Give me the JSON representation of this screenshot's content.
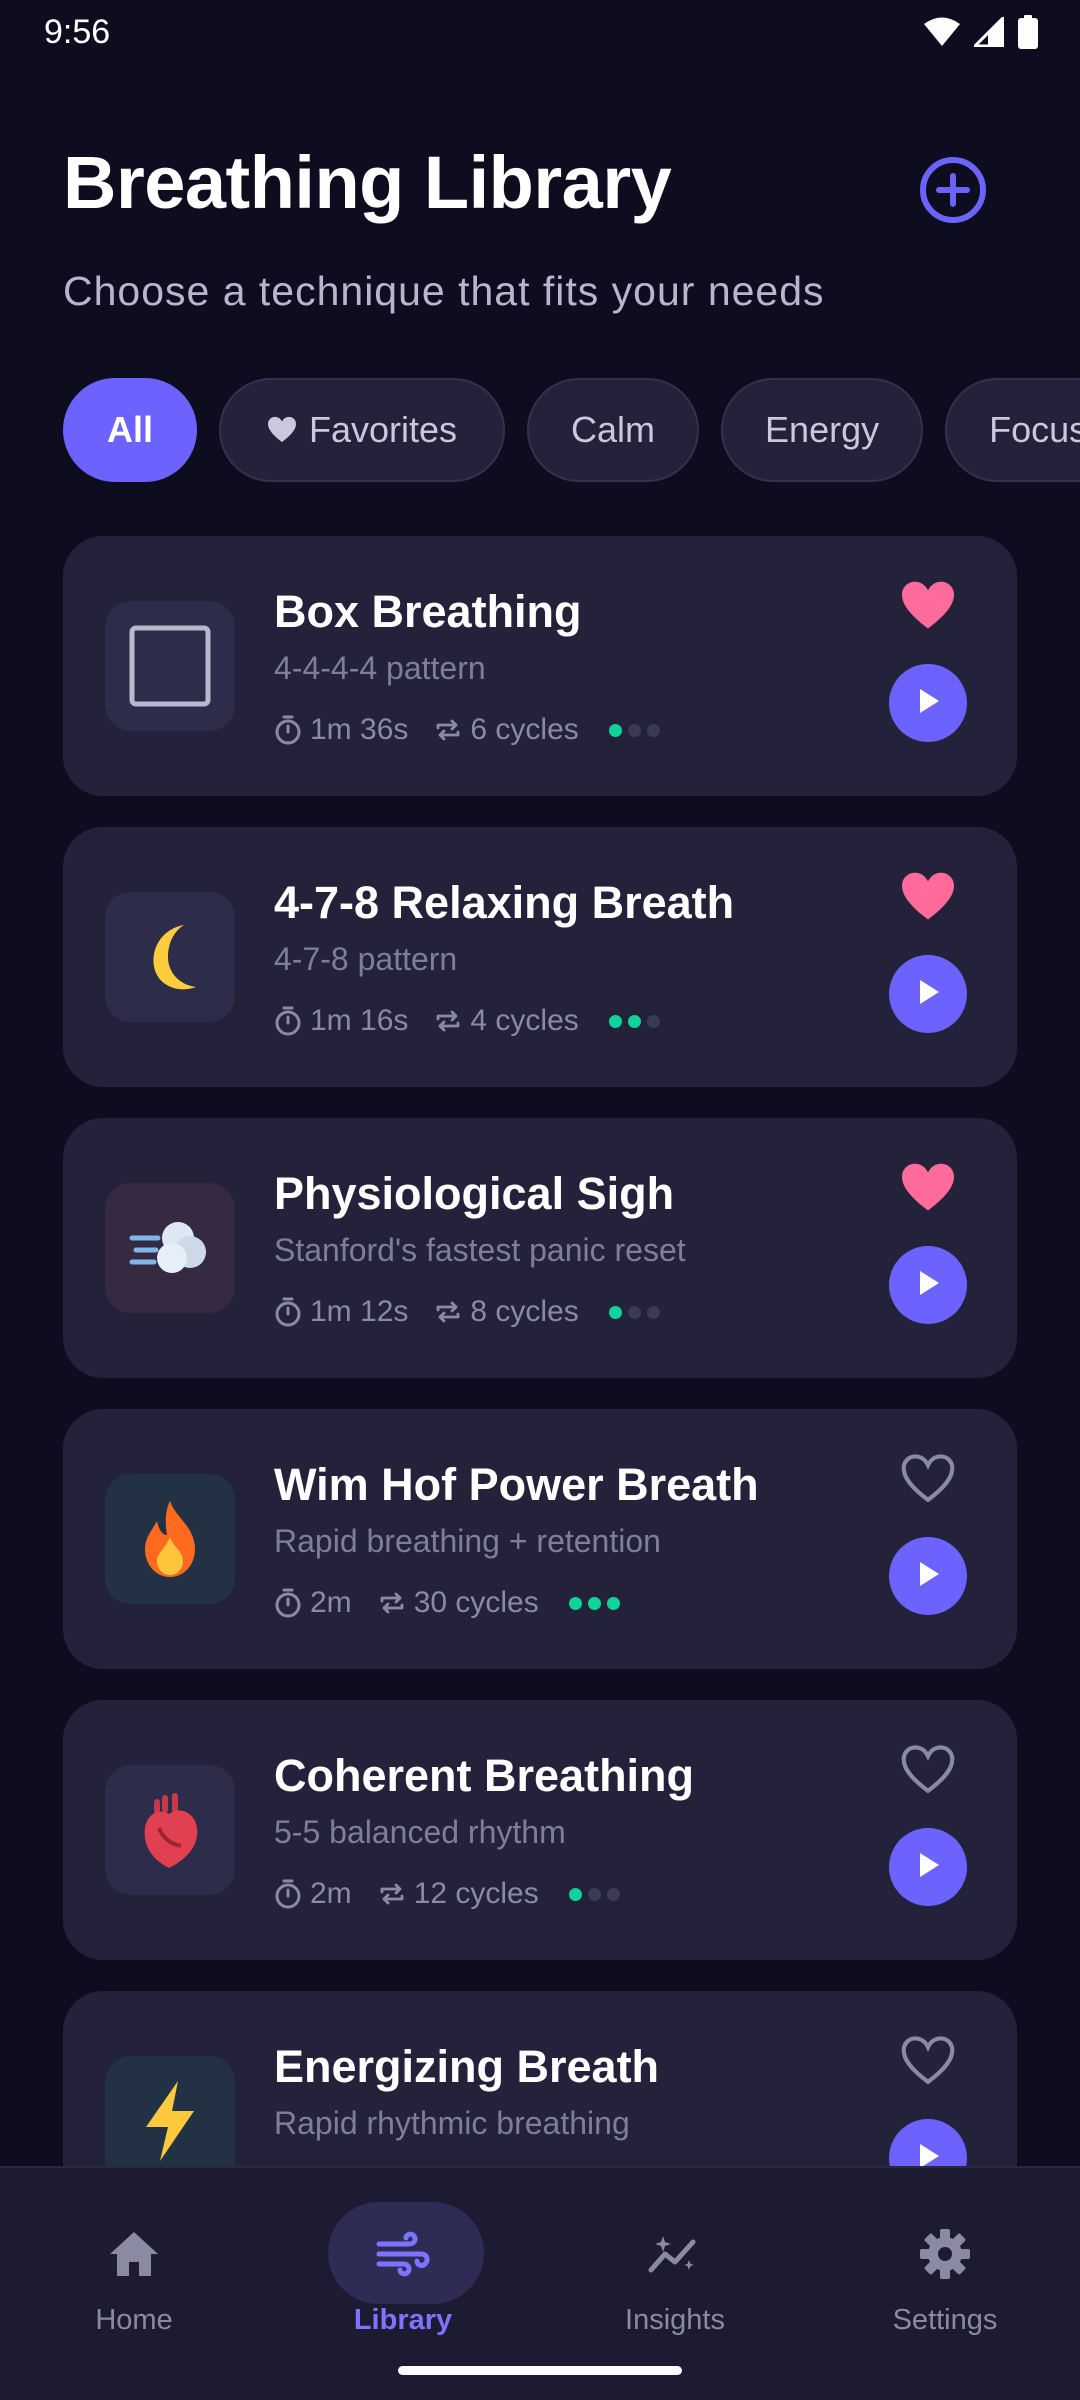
{
  "status_bar": {
    "time": "9:56"
  },
  "header": {
    "title": "Breathing Library",
    "subtitle": "Choose a technique that fits your needs"
  },
  "filters": [
    {
      "label": "All",
      "active": true
    },
    {
      "label": "Favorites",
      "active": false
    },
    {
      "label": "Calm",
      "active": false
    },
    {
      "label": "Energy",
      "active": false
    },
    {
      "label": "Focus",
      "active": false
    }
  ],
  "techniques": [
    {
      "title": "Box Breathing",
      "subtitle": "4-4-4-4 pattern",
      "duration": "1m 36s",
      "cycles": "6 cycles",
      "intensity": 1,
      "favorite": true,
      "icon": "square-icon",
      "icon_bg": "#2d2c4a"
    },
    {
      "title": "4-7-8 Relaxing Breath",
      "subtitle": "4-7-8 pattern",
      "duration": "1m 16s",
      "cycles": "4 cycles",
      "intensity": 2,
      "favorite": true,
      "icon": "moon-icon",
      "icon_bg": "#2d2c4a"
    },
    {
      "title": "Physiological Sigh",
      "subtitle": "Stanford's fastest panic reset",
      "duration": "1m 12s",
      "cycles": "8 cycles",
      "intensity": 1,
      "favorite": true,
      "icon": "wind-puff-icon",
      "icon_bg": "#352a42"
    },
    {
      "title": "Wim Hof Power Breath",
      "subtitle": "Rapid breathing + retention",
      "duration": "2m",
      "cycles": "30 cycles",
      "intensity": 3,
      "favorite": false,
      "icon": "fire-icon",
      "icon_bg": "#223144"
    },
    {
      "title": "Coherent Breathing",
      "subtitle": "5-5 balanced rhythm",
      "duration": "2m",
      "cycles": "12 cycles",
      "intensity": 1,
      "favorite": false,
      "icon": "heart-organ-icon",
      "icon_bg": "#2d2c4a"
    },
    {
      "title": "Energizing Breath",
      "subtitle": "Rapid rhythmic breathing",
      "duration": "",
      "cycles": "",
      "intensity": 0,
      "favorite": false,
      "icon": "lightning-icon",
      "icon_bg": "#223144"
    }
  ],
  "nav": [
    {
      "label": "Home",
      "icon": "home-icon",
      "active": false
    },
    {
      "label": "Library",
      "icon": "wind-icon",
      "active": true
    },
    {
      "label": "Insights",
      "icon": "insights-icon",
      "active": false
    },
    {
      "label": "Settings",
      "icon": "gear-icon",
      "active": false
    }
  ],
  "colors": {
    "accent": "#6c63ff",
    "favorite": "#ff6b9a",
    "intensity": "#10d39a",
    "background": "#0e0d1f",
    "card": "#23223a"
  }
}
